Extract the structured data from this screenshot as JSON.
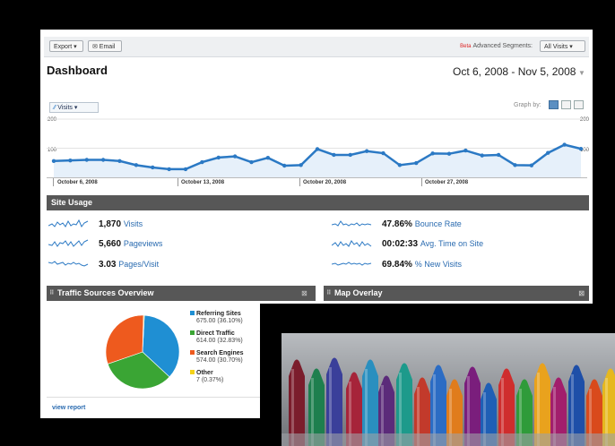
{
  "toolbar": {
    "export_label": "Export ▾",
    "email_label": "✉ Email",
    "beta_label": "Beta",
    "segments_label": "Advanced Segments:",
    "segments_value": "All Visits ▾"
  },
  "header": {
    "title": "Dashboard",
    "date_range": "Oct 6, 2008 - Nov 5, 2008"
  },
  "graph": {
    "tab_label": "Visits ▾",
    "graph_by_label": "Graph by:"
  },
  "chart_data": {
    "type": "line",
    "ylim": [
      0,
      200
    ],
    "y_ticks_left": [
      "200",
      "100"
    ],
    "y_ticks_right": [
      "200",
      "100"
    ],
    "x_ticks": [
      "October 6, 2008",
      "October 13, 2008",
      "October 20, 2008",
      "October 27, 2008"
    ],
    "series": [
      {
        "values": [
          56,
          58,
          60,
          60,
          56,
          42,
          34,
          28,
          28,
          52,
          68,
          72,
          52,
          67,
          40,
          42,
          97,
          77,
          77,
          90,
          83,
          42,
          49,
          82,
          81,
          92,
          75,
          77,
          42,
          41,
          84,
          112,
          98
        ],
        "color": "#2b79c4"
      }
    ]
  },
  "site_usage": {
    "title": "Site Usage",
    "left": [
      {
        "value": "1,870",
        "label": "Visits"
      },
      {
        "value": "5,660",
        "label": "Pageviews"
      },
      {
        "value": "3.03",
        "label": "Pages/Visit"
      }
    ],
    "right": [
      {
        "value": "47.86%",
        "label": "Bounce Rate"
      },
      {
        "value": "00:02:33",
        "label": "Avg. Time on Site"
      },
      {
        "value": "69.84%",
        "label": "% New Visits"
      }
    ]
  },
  "traffic": {
    "title": "Traffic Sources Overview",
    "map_title": "Map Overlay",
    "slices": [
      {
        "name": "Referring Sites",
        "value": "675.00 (36.10%)",
        "pct": 36.1,
        "color": "#1f8fd3"
      },
      {
        "name": "Direct Traffic",
        "value": "614.00 (32.83%)",
        "pct": 32.83,
        "color": "#3aa534"
      },
      {
        "name": "Search Engines",
        "value": "574.00 (30.70%)",
        "pct": 30.7,
        "color": "#ee5a1e"
      },
      {
        "name": "Other",
        "value": "7 (0.37%)",
        "pct": 0.37,
        "color": "#f4d218"
      }
    ],
    "view_report": "view report"
  }
}
